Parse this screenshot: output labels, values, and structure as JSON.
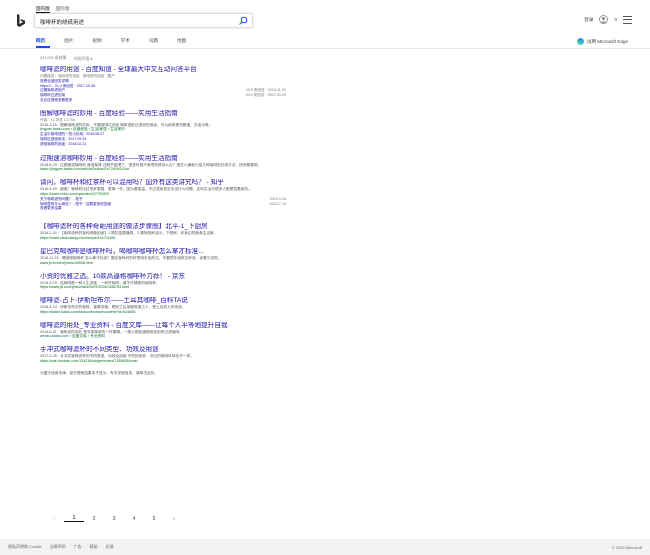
{
  "header": {
    "region_tabs": [
      "国内版",
      "国际版"
    ],
    "query": "咖啡杯的绕纸用途",
    "signin": "登录",
    "rewards": "0"
  },
  "scopes": [
    "网页",
    "图片",
    "视频",
    "学术",
    "词典",
    "地图"
  ],
  "edge_promo": "试用 Microsoft Edge",
  "count": "237,000 条结果",
  "time_filter": "时间不限 ▾",
  "results": [
    {
      "title_pre": "咖啡滤的用途 - 百度知道 - 全球最大中文互动问答平台",
      "lines": [
        {
          "t": "meta",
          "v": "问题描述：咖啡滤的用途 · 咖啡滤的用途 · 置产"
        },
        {
          "t": "link",
          "v": "查看全部回答详情"
        },
        {
          "t": "row",
          "l": "https://...  21.4 条回答 · 2017-10-08",
          "r": ""
        },
        {
          "t": "row",
          "l": "过期咖啡滤用户",
          "r": "20.5 条回答 · 2016-11-02"
        },
        {
          "t": "row",
          "l": "咖啡杯过滤的用",
          "r": "20.4 条回答 · 2007-03-09"
        },
        {
          "t": "link",
          "v": "去必应搜索查看更多"
        }
      ]
    },
    {
      "title_pre": "图解咖啡滤的妙用 - 百度经验——实用生活指南",
      "lines": [
        {
          "t": "meta",
          "v": "作者：11 浏览 13,788"
        },
        {
          "t": "snip",
          "v": "2016-3-16 · 图解咖啡滤的妙用，不要咖啡过滤纸 咖啡滤纸过滤纸的用途。可以用来擦洗餐桌、去油污等。"
        },
        {
          "t": "url",
          "v": "jingyan.baidu.com › 百度经验 › 生活/家居 › 生活常识"
        },
        {
          "t": "sub",
          "v": "生活中咖啡滤的一些小妙用 · 2018.06.07"
        },
        {
          "t": "sub",
          "v": "咖啡过滤纸用法 · 2017.09.29"
        },
        {
          "t": "sub",
          "v": "滤纸咖啡的用途 · 2018.02.21"
        }
      ]
    },
    {
      "title_pre": "过期速溶咖啡妙用 - 百度经验——实用生活指南",
      "lines": [
        {
          "t": "snip",
          "v": "2018-8-29 · 过期速溶咖啡粉 速溶咖啡 过期不能喝了，很多时候不舍得扔掉怎么办？现在小编就介绍几种咖啡的妙用方法，快来看看吧。"
        },
        {
          "t": "url",
          "v": "https://jingyan.baidu.com/article/0cdcad7e72915412cd"
        }
      ]
    },
    {
      "title_pre": "请问，咖啡杯和红茶杯可以混用吗？国外有这类讲究吗？ - 知乎",
      "lines": [
        {
          "t": "snip",
          "v": "2016-5-30 · 谢邀！咖啡杯比红茶杯更矮、更厚一些，因为要保温。不过混用其实也没什么问题，实际生活中很多人都是混着用的。"
        },
        {
          "t": "url",
          "v": "https://www.zhihu.com/question/27791902"
        },
        {
          "t": "row",
          "l": "关于咖啡滤的问题？ - 知乎",
          "r": "2015-9-18"
        },
        {
          "t": "row",
          "l": "咖啡壶有什么用处？ - 知乎 · 加载更多的答案",
          "r": "2012-7-19"
        },
        {
          "t": "link",
          "v": "查看更多结果"
        }
      ]
    },
    {
      "title_pre": "【咖啡滤杯的各种奇葩用途的做法步骤图】北平-1_下厨房",
      "lines": [
        {
          "t": "snip",
          "v": "2016-2-20 · 【咖啡滤杯的各种奇葩用途】1.擦拭金属器具。2.清除厨房油污。下厨房，你身边的美食生活家。"
        },
        {
          "t": "url",
          "v": "https://www.xiachufang.com/recipe/101711551"
        }
      ]
    },
    {
      "title_pre": "星巴克喝咖啡是咖啡杯吗，喝咖啡咖啡杯怎么拿才标准...",
      "lines": [
        {
          "t": "snip",
          "v": "2018-11-15 · 喝咖啡咖啡杯 怎么拿才标准？握住咖啡杯的杯把用手指托住，不要把手指穿过杯耳，优雅又讲究。"
        },
        {
          "t": "url",
          "v": "www.jd-tv.com/photo/40008.html"
        }
      ]
    },
    {
      "title_pre": "小资的优雅之选。10款高逼格咖啡杯力荐！ - 京东",
      "lines": [
        {
          "t": "snip",
          "v": "2018-9-19 · 品咖啡是一种人生态度，一杯好咖啡，离不开精美的咖啡杯。"
        },
        {
          "t": "url",
          "v": "https://www.jd.com/phb/zhishi/9e0192f3a7a38754.html"
        }
      ]
    },
    {
      "title_pre": "咖啡滤-占卜-伊斯坦布尔——土耳其咖啡_百科TA说",
      "lines": [
        {
          "t": "snip",
          "v": "2018-4-14 · 伊斯坦布尔的咖啡，香醇浓郁。喝完之后用咖啡渣占卜，是土耳其人的传统。"
        },
        {
          "t": "url",
          "v": "https://baike.baidu.com/tashuo/browse/content?id=b24d65"
        }
      ]
    },
    {
      "title_pre": "咖啡滤的用处_专业资料 - 百度文库——让每个人平等地提升自我",
      "lines": [
        {
          "t": "snip",
          "v": "2018-6-21 · 咖啡滤的用处 是非常简单的一件事情。一般人都知道咖啡滤用来过滤咖啡。"
        },
        {
          "t": "url",
          "v": "wenku.baidu.com › 百度文库 › 专业资料"
        }
      ]
    },
    {
      "title_pre": "手冲式咖啡滤杯的不同类型、功效及用途",
      "lines": [
        {
          "t": "snip",
          "v": "2017-5-25 · 手冲式咖啡滤杯的不同类型、功效及用途 不同的滤杯，冲出的咖啡风味也不一样。"
        },
        {
          "t": "url",
          "v": "https://site.douban.com/134216/widget/notes/7155655/note/"
        }
      ]
    }
  ],
  "notice": "为遵守适用法律，部分搜索结果未予显示。有关详细信息，请单击此处。",
  "pagination": {
    "prev": "‹",
    "pages": [
      "1",
      "2",
      "3",
      "4",
      "5"
    ],
    "next": "›"
  },
  "footer": {
    "links": [
      "隐私声明和 Cookie",
      "法律声明",
      "广告",
      "帮助",
      "反馈"
    ],
    "copyright": "© 2019 Microsoft"
  }
}
